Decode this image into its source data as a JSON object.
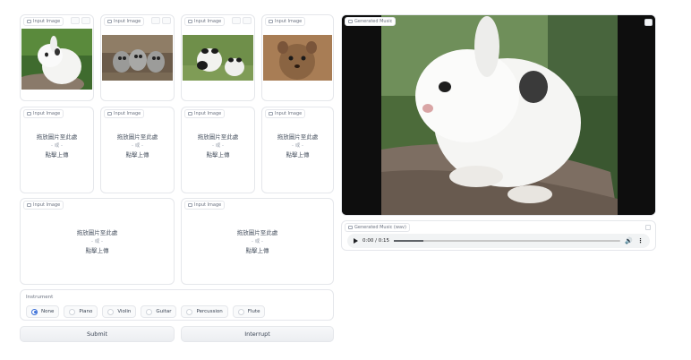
{
  "input_images": {
    "label": "Input Image",
    "drop_line1": "拖放圖片至此處",
    "drop_or": "- 或 -",
    "drop_line2": "點擊上傳"
  },
  "instrument": {
    "label": "Instrument",
    "options": [
      "None",
      "Piano",
      "Violin",
      "Guitar",
      "Percussion",
      "Flute"
    ],
    "selected": "None"
  },
  "buttons": {
    "submit": "Submit",
    "interrupt": "Interrupt"
  },
  "output_image": {
    "label": "Generated Music"
  },
  "audio": {
    "label": "Generated Music (wav)",
    "time": "0:00 / 0:15",
    "progress_fraction": 0.13
  },
  "colors": {
    "accent": "#3b6fd8",
    "border": "#e5e7eb",
    "button_bg": "#eceef1"
  },
  "icons": {
    "image_icon": "image-icon",
    "edit_icon": "pencil-icon",
    "clear_icon": "close-icon",
    "play_icon": "play-icon",
    "volume_icon": "volume-icon",
    "more_icon": "more-vertical-icon",
    "share_icon": "share-icon",
    "fullscreen_icon": "fullscreen-icon"
  }
}
